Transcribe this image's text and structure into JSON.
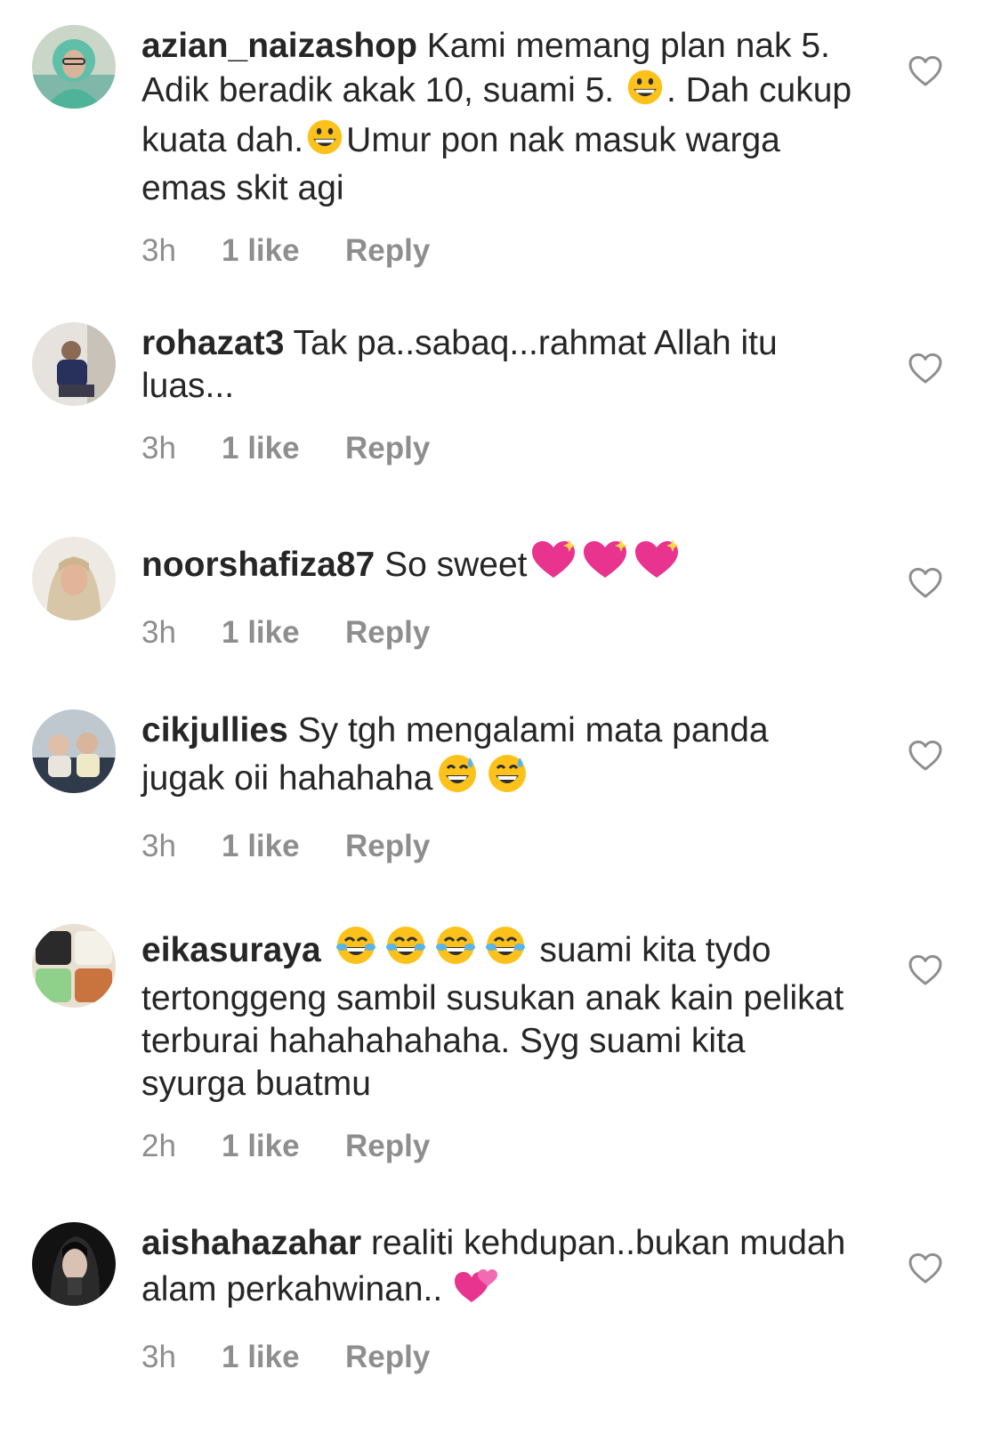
{
  "comments": [
    {
      "username": "azian_naizashop",
      "segments": [
        " Kami memang plan nak 5. Adik beradik akak 10, suami 5. ",
        "grinning-face",
        ". Dah cukup kuata dah.",
        "grinning-face",
        "Umur pon nak masuk warga emas skit agi"
      ],
      "time": "3h",
      "likes": "1 like",
      "reply": "Reply"
    },
    {
      "username": "rohazat3",
      "segments": [
        " Tak pa..sabaq...rahmat Allah itu luas..."
      ],
      "time": "3h",
      "likes": "1 like",
      "reply": "Reply"
    },
    {
      "username": "noorshafiza87",
      "segments": [
        " So sweet",
        "sparkling-heart",
        "sparkling-heart",
        "sparkling-heart"
      ],
      "time": "3h",
      "likes": "1 like",
      "reply": "Reply"
    },
    {
      "username": "cikjullies",
      "segments": [
        " Sy tgh mengalami mata panda jugak oii hahahaha",
        "sweat-smile",
        "sweat-smile"
      ],
      "time": "3h",
      "likes": "1 like",
      "reply": "Reply"
    },
    {
      "username": "eikasuraya",
      "segments": [
        " ",
        "tears-of-joy",
        "tears-of-joy",
        "tears-of-joy",
        "tears-of-joy",
        " suami kita tydo tertonggeng sambil susukan anak kain pelikat terburai hahahahahaha. Syg suami kita syurga buatmu"
      ],
      "time": "2h",
      "likes": "1 like",
      "reply": "Reply"
    },
    {
      "username": "aishahazahar",
      "segments": [
        " realiti kehdupan..bukan mudah alam perkahwinan.. ",
        "two-hearts"
      ],
      "time": "3h",
      "likes": "1 like",
      "reply": "Reply"
    }
  ],
  "colors": {
    "text": "#262626",
    "meta": "#8e8e8e",
    "heart_outline": "#8e8e8e"
  },
  "icons": {
    "like": "heart-outline-icon"
  }
}
